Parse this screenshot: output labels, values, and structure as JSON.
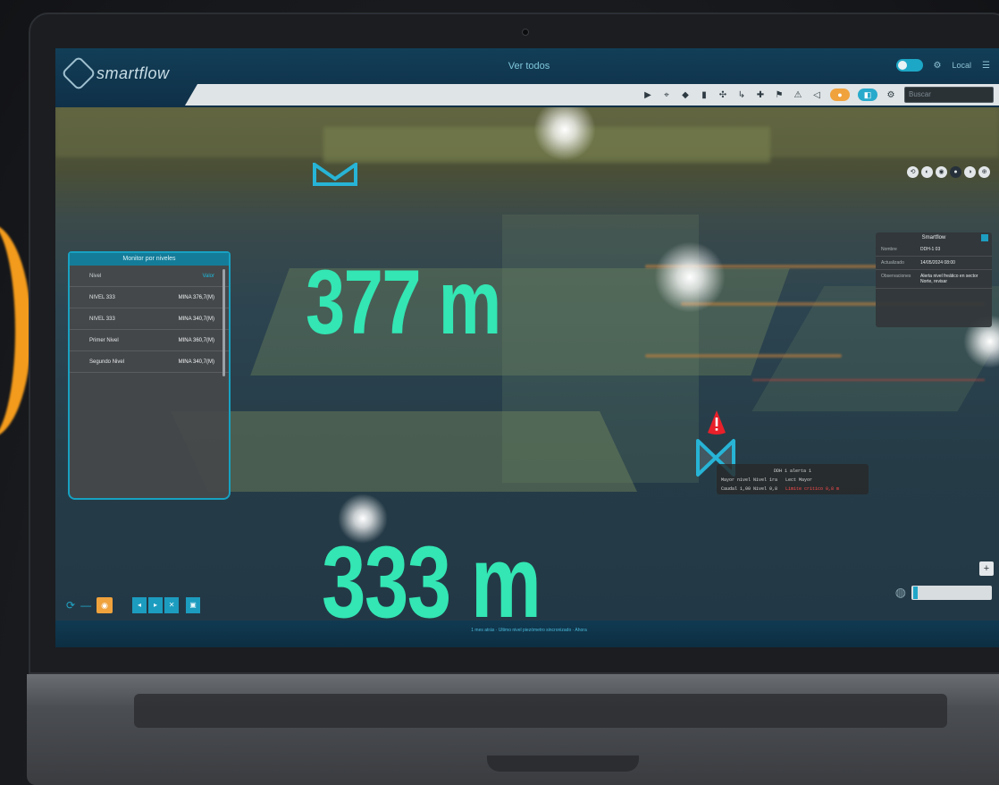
{
  "app": {
    "brand": "smartflow",
    "view_title": "Ver todos"
  },
  "topbar": {
    "toggle_on": true,
    "icon": "settings-icon",
    "user": "Local"
  },
  "toolbar": {
    "tools": [
      "▶",
      "⌖",
      "◆",
      "▮",
      "✣",
      "↳",
      "✚",
      "⚑",
      "⚠",
      "◁"
    ],
    "pill_orange": "●",
    "pill_teal": "◧",
    "gear": "⚙",
    "search_placeholder": "Buscar"
  },
  "side_panel": {
    "title": "Monitor por niveles",
    "header": {
      "label": "Nivel",
      "value": "Valor"
    },
    "rows": [
      {
        "label": "NIVEL 333",
        "value": "MINA 376,7(M)"
      },
      {
        "label": "NIVEL 333",
        "value": "MINA 340,7(M)"
      },
      {
        "label": "Primer Nivel",
        "value": "MINA 360,7(M)"
      },
      {
        "label": "Segundo Nivel",
        "value": "MINA 340,7(M)"
      }
    ]
  },
  "distances": {
    "upper": "377 m",
    "lower": "333 m"
  },
  "tooltip": {
    "title": "DDH 1 alerta 1",
    "line1_label": "Mayor nivel Nivel 1ra",
    "line1_value": "Lect Mayor",
    "line2_label": "Caudal 1,00 Nivel 0,8",
    "line2_value": "Limite critico 0,8 m"
  },
  "info_panel": {
    "title": "Smartflow",
    "rows": [
      {
        "key": "Nombre",
        "value": "DDH-1 03"
      },
      {
        "key": "Actualizado",
        "value": "14/05/2024 08:00"
      },
      {
        "key": "Observaciones",
        "value": "Alerta nivel freático en sector Norte, revisar"
      }
    ]
  },
  "nav": {
    "buttons": [
      "⟲",
      "◐",
      "◉",
      "●",
      "◑",
      "⊕"
    ]
  },
  "bottom": {
    "timeline_text": "1 mes atrás · Ultimo nivel piezómetro sincronizado · Ahora",
    "left_icon": "⟳",
    "left_orange": "◉",
    "buttons": [
      "◂",
      "▸",
      "✕",
      "▣"
    ],
    "plus": "+",
    "slider_value": 0.02,
    "slider_icon": "globe-icon"
  },
  "colors": {
    "accent": "#1da7c6",
    "distance_text": "#33e6b3",
    "alert": "#e8202a",
    "orange": "#f0a23c"
  }
}
